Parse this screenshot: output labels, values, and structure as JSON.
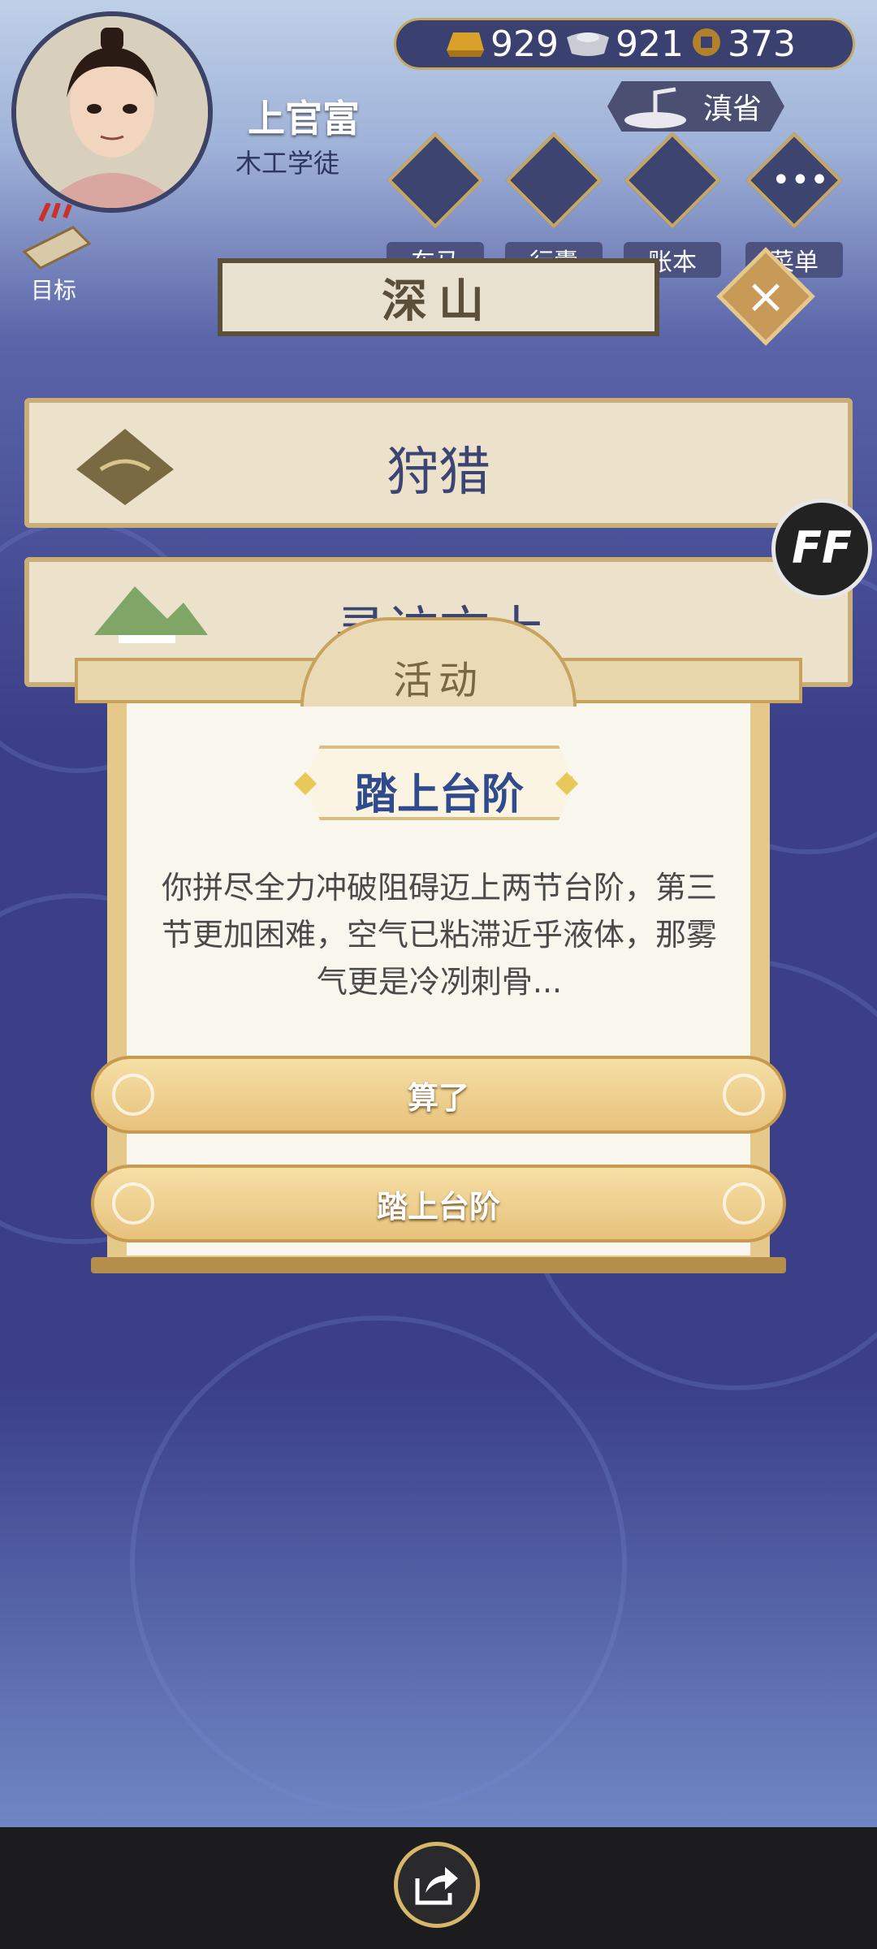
{
  "header": {
    "player_name": "上官富",
    "player_title": "木工学徒",
    "currency": [
      {
        "icon": "gold-ingot-icon",
        "value": "929"
      },
      {
        "icon": "silver-ingot-icon",
        "value": "921"
      },
      {
        "icon": "copper-coin-icon",
        "value": "373"
      }
    ],
    "province": "滇省",
    "menu": [
      {
        "label": "车马",
        "icon": "carriage-icon"
      },
      {
        "label": "行囊",
        "icon": "bag-icon"
      },
      {
        "label": "账本",
        "icon": "ledger-icon"
      },
      {
        "label": "菜单",
        "icon": "more-icon"
      }
    ],
    "goal_label": "目标"
  },
  "location": {
    "name": "深山"
  },
  "activities": [
    {
      "label": "狩猎",
      "icon": "hunting-icon"
    },
    {
      "label": "寻访方士",
      "icon": "mountain-icon"
    }
  ],
  "ff_button": "FF",
  "dialog": {
    "header": "活动",
    "event_title": "踏上台阶",
    "body": "你拼尽全力冲破阻碍迈上两节台阶，第三节更加困难，空气已粘滞近乎液体，那雾气更是冷冽刺骨...",
    "options": [
      "算了",
      "踏上台阶"
    ]
  },
  "colors": {
    "accent_gold": "#c8a35d",
    "panel_navy": "#3b4070",
    "event_title_blue": "#2f4b8c"
  }
}
